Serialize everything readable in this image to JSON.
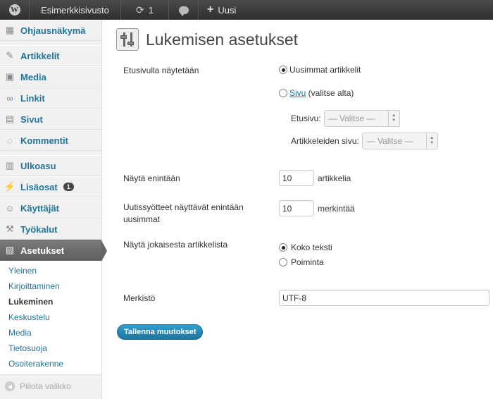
{
  "adminbar": {
    "site_name": "Esimerkkisivusto",
    "updates_count": "1",
    "new_label": "Uusi"
  },
  "sidebar": {
    "items": [
      {
        "label": "Ohjausnäkymä",
        "icon": "dashboard-icon"
      },
      {
        "label": "Artikkelit",
        "icon": "pin-icon"
      },
      {
        "label": "Media",
        "icon": "media-icon"
      },
      {
        "label": "Linkit",
        "icon": "link-icon"
      },
      {
        "label": "Sivut",
        "icon": "pages-icon"
      },
      {
        "label": "Kommentit",
        "icon": "comment-icon"
      },
      {
        "label": "Ulkoasu",
        "icon": "appearance-icon"
      },
      {
        "label": "Lisäosat",
        "icon": "plugin-icon",
        "badge": "1"
      },
      {
        "label": "Käyttäjät",
        "icon": "users-icon"
      },
      {
        "label": "Työkalut",
        "icon": "tools-icon"
      },
      {
        "label": "Asetukset",
        "icon": "settings-icon"
      }
    ],
    "submenu": [
      "Yleinen",
      "Kirjoittaminen",
      "Lukeminen",
      "Keskustelu",
      "Media",
      "Tietosuoja",
      "Osoiterakenne"
    ],
    "active_submenu": "Lukeminen",
    "collapse_label": "Piilota valikko"
  },
  "page": {
    "title": "Lukemisen asetukset"
  },
  "form": {
    "front_page_label": "Etusivulla näytetään",
    "option_latest": "Uusimmat artikkelit",
    "option_page_link": "Sivu",
    "option_page_suffix": " (valitse alta)",
    "front_page_select_label": "Etusivu:",
    "front_page_select_value": "— Valitse —",
    "posts_page_select_label": "Artikkeleiden sivu:",
    "posts_page_select_value": "— Valitse —",
    "show_at_most_label": "Näytä enintään",
    "show_at_most_value": "10",
    "show_at_most_unit": "artikkelia",
    "feed_label": "Uutissyötteet näyttävät enintään uusimmat",
    "feed_value": "10",
    "feed_unit": "merkintää",
    "each_article_label": "Näytä jokaisesta artikkelista",
    "option_full_text": "Koko teksti",
    "option_summary": "Poiminta",
    "encoding_label": "Merkistö",
    "encoding_value": "UTF-8",
    "save_button": "Tallenna muutokset"
  },
  "colors": {
    "link": "#21759b",
    "adminbar": "#464646",
    "button": "#21759b"
  }
}
